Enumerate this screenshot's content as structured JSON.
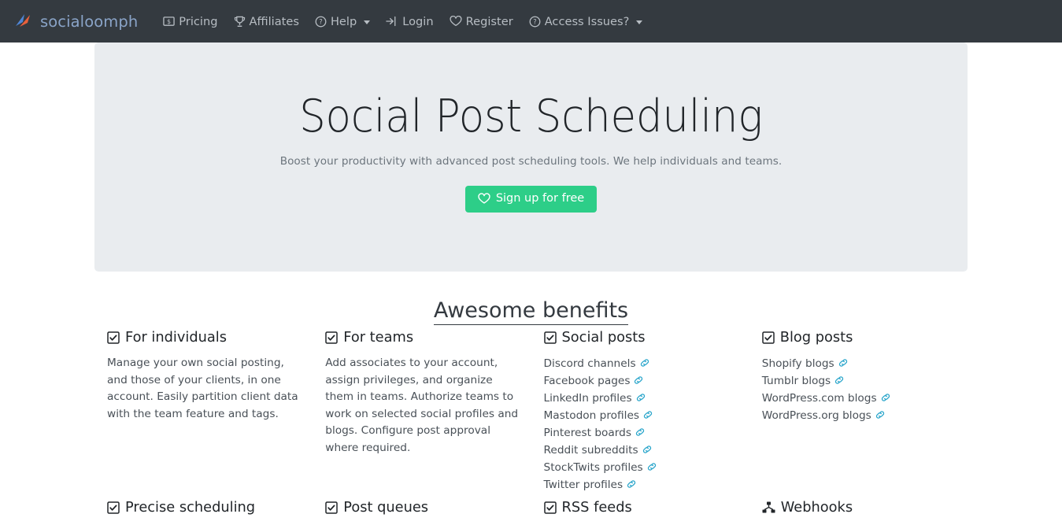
{
  "navbar": {
    "brand": "socialoomph",
    "brand_color": "#8aa4c8",
    "background_color": "#343a40",
    "items": [
      {
        "label": "Pricing",
        "icon": "money-bill-icon",
        "caret": false
      },
      {
        "label": "Affiliates",
        "icon": "trophy-icon",
        "caret": false
      },
      {
        "label": "Help",
        "icon": "question-circle-icon",
        "caret": true
      },
      {
        "label": "Login",
        "icon": "sign-in-icon",
        "caret": false
      },
      {
        "label": "Register",
        "icon": "heart-icon",
        "caret": false
      },
      {
        "label": "Access Issues?",
        "icon": "question-circle-icon",
        "caret": true
      }
    ]
  },
  "hero": {
    "title": "Social Post Scheduling",
    "subtitle": "Boost your productivity with advanced post scheduling tools. We help individuals and teams.",
    "cta_label": "Sign up for free",
    "cta_icon": "heart-icon",
    "cta_color": "#2dce88",
    "background_color": "#e9ecef"
  },
  "benefits": {
    "heading": "Awesome benefits",
    "columns": [
      {
        "icon": "check-square-icon",
        "title": "For individuals",
        "body": "Manage your own social posting, and those of your clients, in one account. Easily partition client data with the team feature and tags.",
        "links": []
      },
      {
        "icon": "check-square-icon",
        "title": "For teams",
        "body": "Add associates to your account, assign privileges, and organize them in teams. Authorize teams to work on selected social profiles and blogs. Configure post approval where required.",
        "links": []
      },
      {
        "icon": "check-square-icon",
        "title": "Social posts",
        "body": "",
        "links": [
          "Discord channels",
          "Facebook pages",
          "LinkedIn profiles",
          "Mastodon profiles",
          "Pinterest boards",
          "Reddit subreddits",
          "StockTwits profiles",
          "Twitter profiles"
        ]
      },
      {
        "icon": "check-square-icon",
        "title": "Blog posts",
        "body": "",
        "links": [
          "Shopify blogs",
          "Tumblr blogs",
          "WordPress.com blogs",
          "WordPress.org blogs"
        ]
      }
    ],
    "link_icon": "chain-link-icon",
    "link_icon_color": "#2ba6cb",
    "next_row": [
      {
        "icon": "check-square-icon",
        "title": "Precise scheduling"
      },
      {
        "icon": "check-square-icon",
        "title": "Post queues"
      },
      {
        "icon": "check-square-icon",
        "title": "RSS feeds"
      },
      {
        "icon": "project-diagram-icon",
        "title": "Webhooks"
      }
    ]
  }
}
